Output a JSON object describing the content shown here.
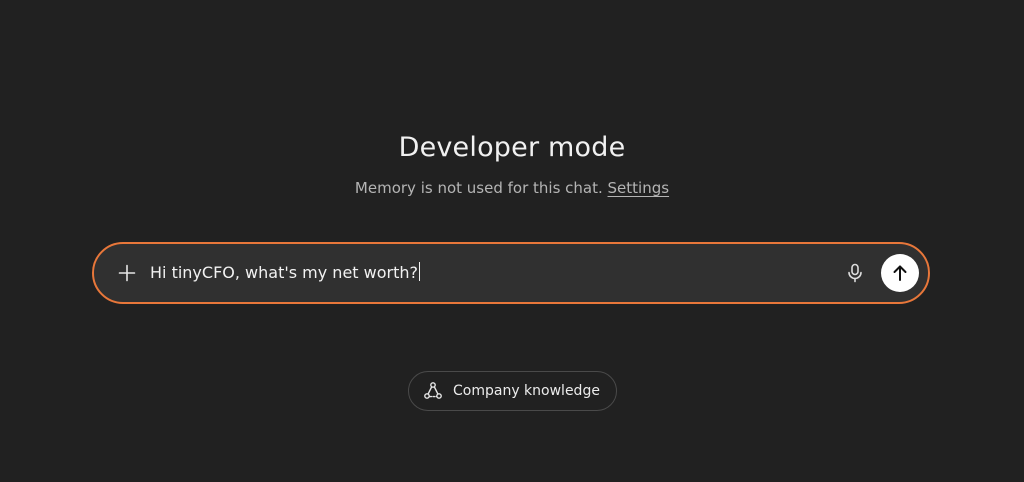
{
  "header": {
    "title": "Developer mode",
    "subtitle_text": "Memory is not used for this chat.",
    "settings_link": "Settings"
  },
  "composer": {
    "input_value": "Hi tinyCFO, what's my net worth?",
    "add_icon": "plus-icon",
    "mic_icon": "microphone-icon",
    "send_icon": "arrow-up-icon",
    "focus_color": "#e8773a"
  },
  "suggestions": {
    "company_knowledge_label": "Company knowledge",
    "company_knowledge_icon": "connections-icon"
  }
}
